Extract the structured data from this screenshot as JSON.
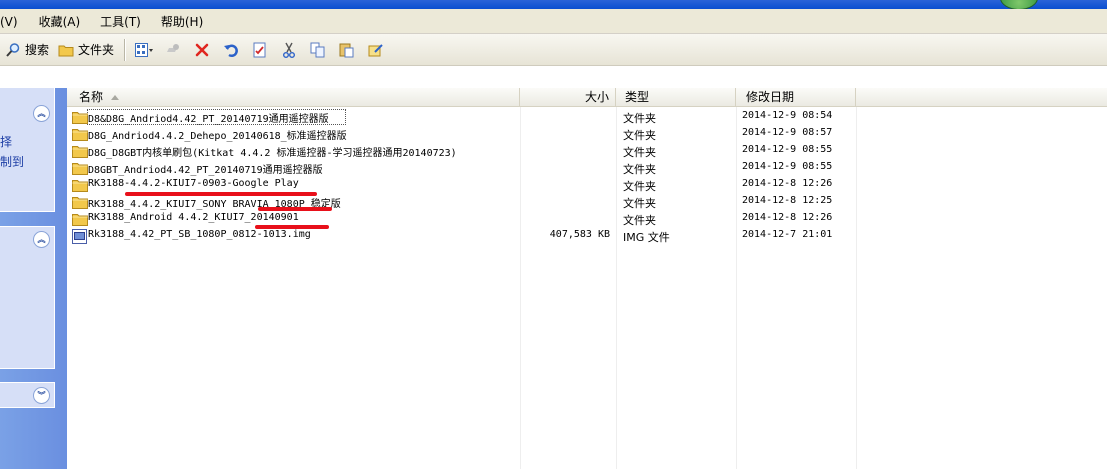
{
  "menubar": {
    "items": [
      "看(V)",
      "收藏(A)",
      "工具(T)",
      "帮助(H)"
    ]
  },
  "toolbar": {
    "search_label": "搜索",
    "folders_label": "文件夹"
  },
  "taskpane": {
    "box1_text_a": "择",
    "box1_text_b": "制到"
  },
  "columns": {
    "name": "名称",
    "size": "大小",
    "type": "类型",
    "date": "修改日期"
  },
  "files": [
    {
      "name": "D8&D8G_Andriod4.42_PT_20140719通用遥控器版",
      "size": "",
      "type": "文件夹",
      "date": "2014-12-9 08:54",
      "kind": "folder"
    },
    {
      "name": "D8G_Andriod4.4.2_Dehepo_20140618_标准遥控器版",
      "size": "",
      "type": "文件夹",
      "date": "2014-12-9 08:57",
      "kind": "folder"
    },
    {
      "name": "D8G_D8GBT内核单刷包(Kitkat 4.4.2 标准遥控器-学习遥控器通用20140723)",
      "size": "",
      "type": "文件夹",
      "date": "2014-12-9 08:55",
      "kind": "folder"
    },
    {
      "name": "D8GBT_Andriod4.42_PT_20140719通用遥控器版",
      "size": "",
      "type": "文件夹",
      "date": "2014-12-9 08:55",
      "kind": "folder"
    },
    {
      "name": "RK3188-4.4.2-KIUI7-0903-Google Play",
      "size": "",
      "type": "文件夹",
      "date": "2014-12-8 12:26",
      "kind": "folder"
    },
    {
      "name": "RK3188_4.4.2_KIUI7_SONY BRAVIA  1080P 稳定版",
      "size": "",
      "type": "文件夹",
      "date": "2014-12-8 12:25",
      "kind": "folder"
    },
    {
      "name": "RK3188_Android 4.4.2_KIUI7_20140901",
      "size": "",
      "type": "文件夹",
      "date": "2014-12-8 12:26",
      "kind": "folder"
    },
    {
      "name": "Rk3188_4.42_PT_SB_1080P_0812-1013.img",
      "size": "407,583 KB",
      "type": "IMG 文件",
      "date": "2014-12-7 21:01",
      "kind": "img"
    }
  ],
  "colors": {
    "taskpane": "#6a8fe0",
    "folder": "#f2c84b",
    "annotation": "#e8101a"
  }
}
